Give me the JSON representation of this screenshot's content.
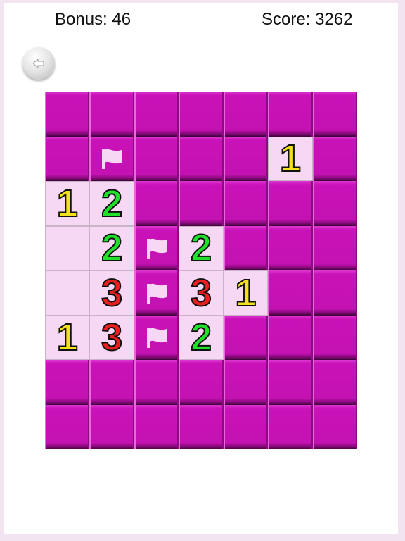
{
  "hud": {
    "bonus_label": "Bonus: 46",
    "score_label": "Score: 3262"
  },
  "icons": {
    "back": "arrow-left-icon",
    "flag": "flag-icon"
  },
  "colors": {
    "covered_tile": "#c912b8",
    "revealed_tile": "#f6d8f4",
    "num_1": "#f3e11c",
    "num_2": "#1fe02a",
    "num_3": "#e81f1f",
    "flag": "#f6d8f4"
  },
  "board": {
    "rows": 8,
    "cols": 7,
    "legend": "C = covered tile, F = flagged covered tile, 0 = revealed empty, 1-3 = revealed number",
    "grid": [
      [
        "C",
        "C",
        "C",
        "C",
        "C",
        "C",
        "C"
      ],
      [
        "C",
        "F",
        "C",
        "C",
        "C",
        "1",
        "C"
      ],
      [
        "1",
        "2",
        "C",
        "C",
        "C",
        "C",
        "C"
      ],
      [
        "0",
        "2",
        "F",
        "2",
        "C",
        "C",
        "C"
      ],
      [
        "0",
        "3",
        "F",
        "3",
        "1",
        "C",
        "C"
      ],
      [
        "1",
        "3",
        "F",
        "2",
        "C",
        "C",
        "C"
      ],
      [
        "C",
        "C",
        "C",
        "C",
        "C",
        "C",
        "C"
      ],
      [
        "C",
        "C",
        "C",
        "C",
        "C",
        "C",
        "C"
      ]
    ]
  }
}
